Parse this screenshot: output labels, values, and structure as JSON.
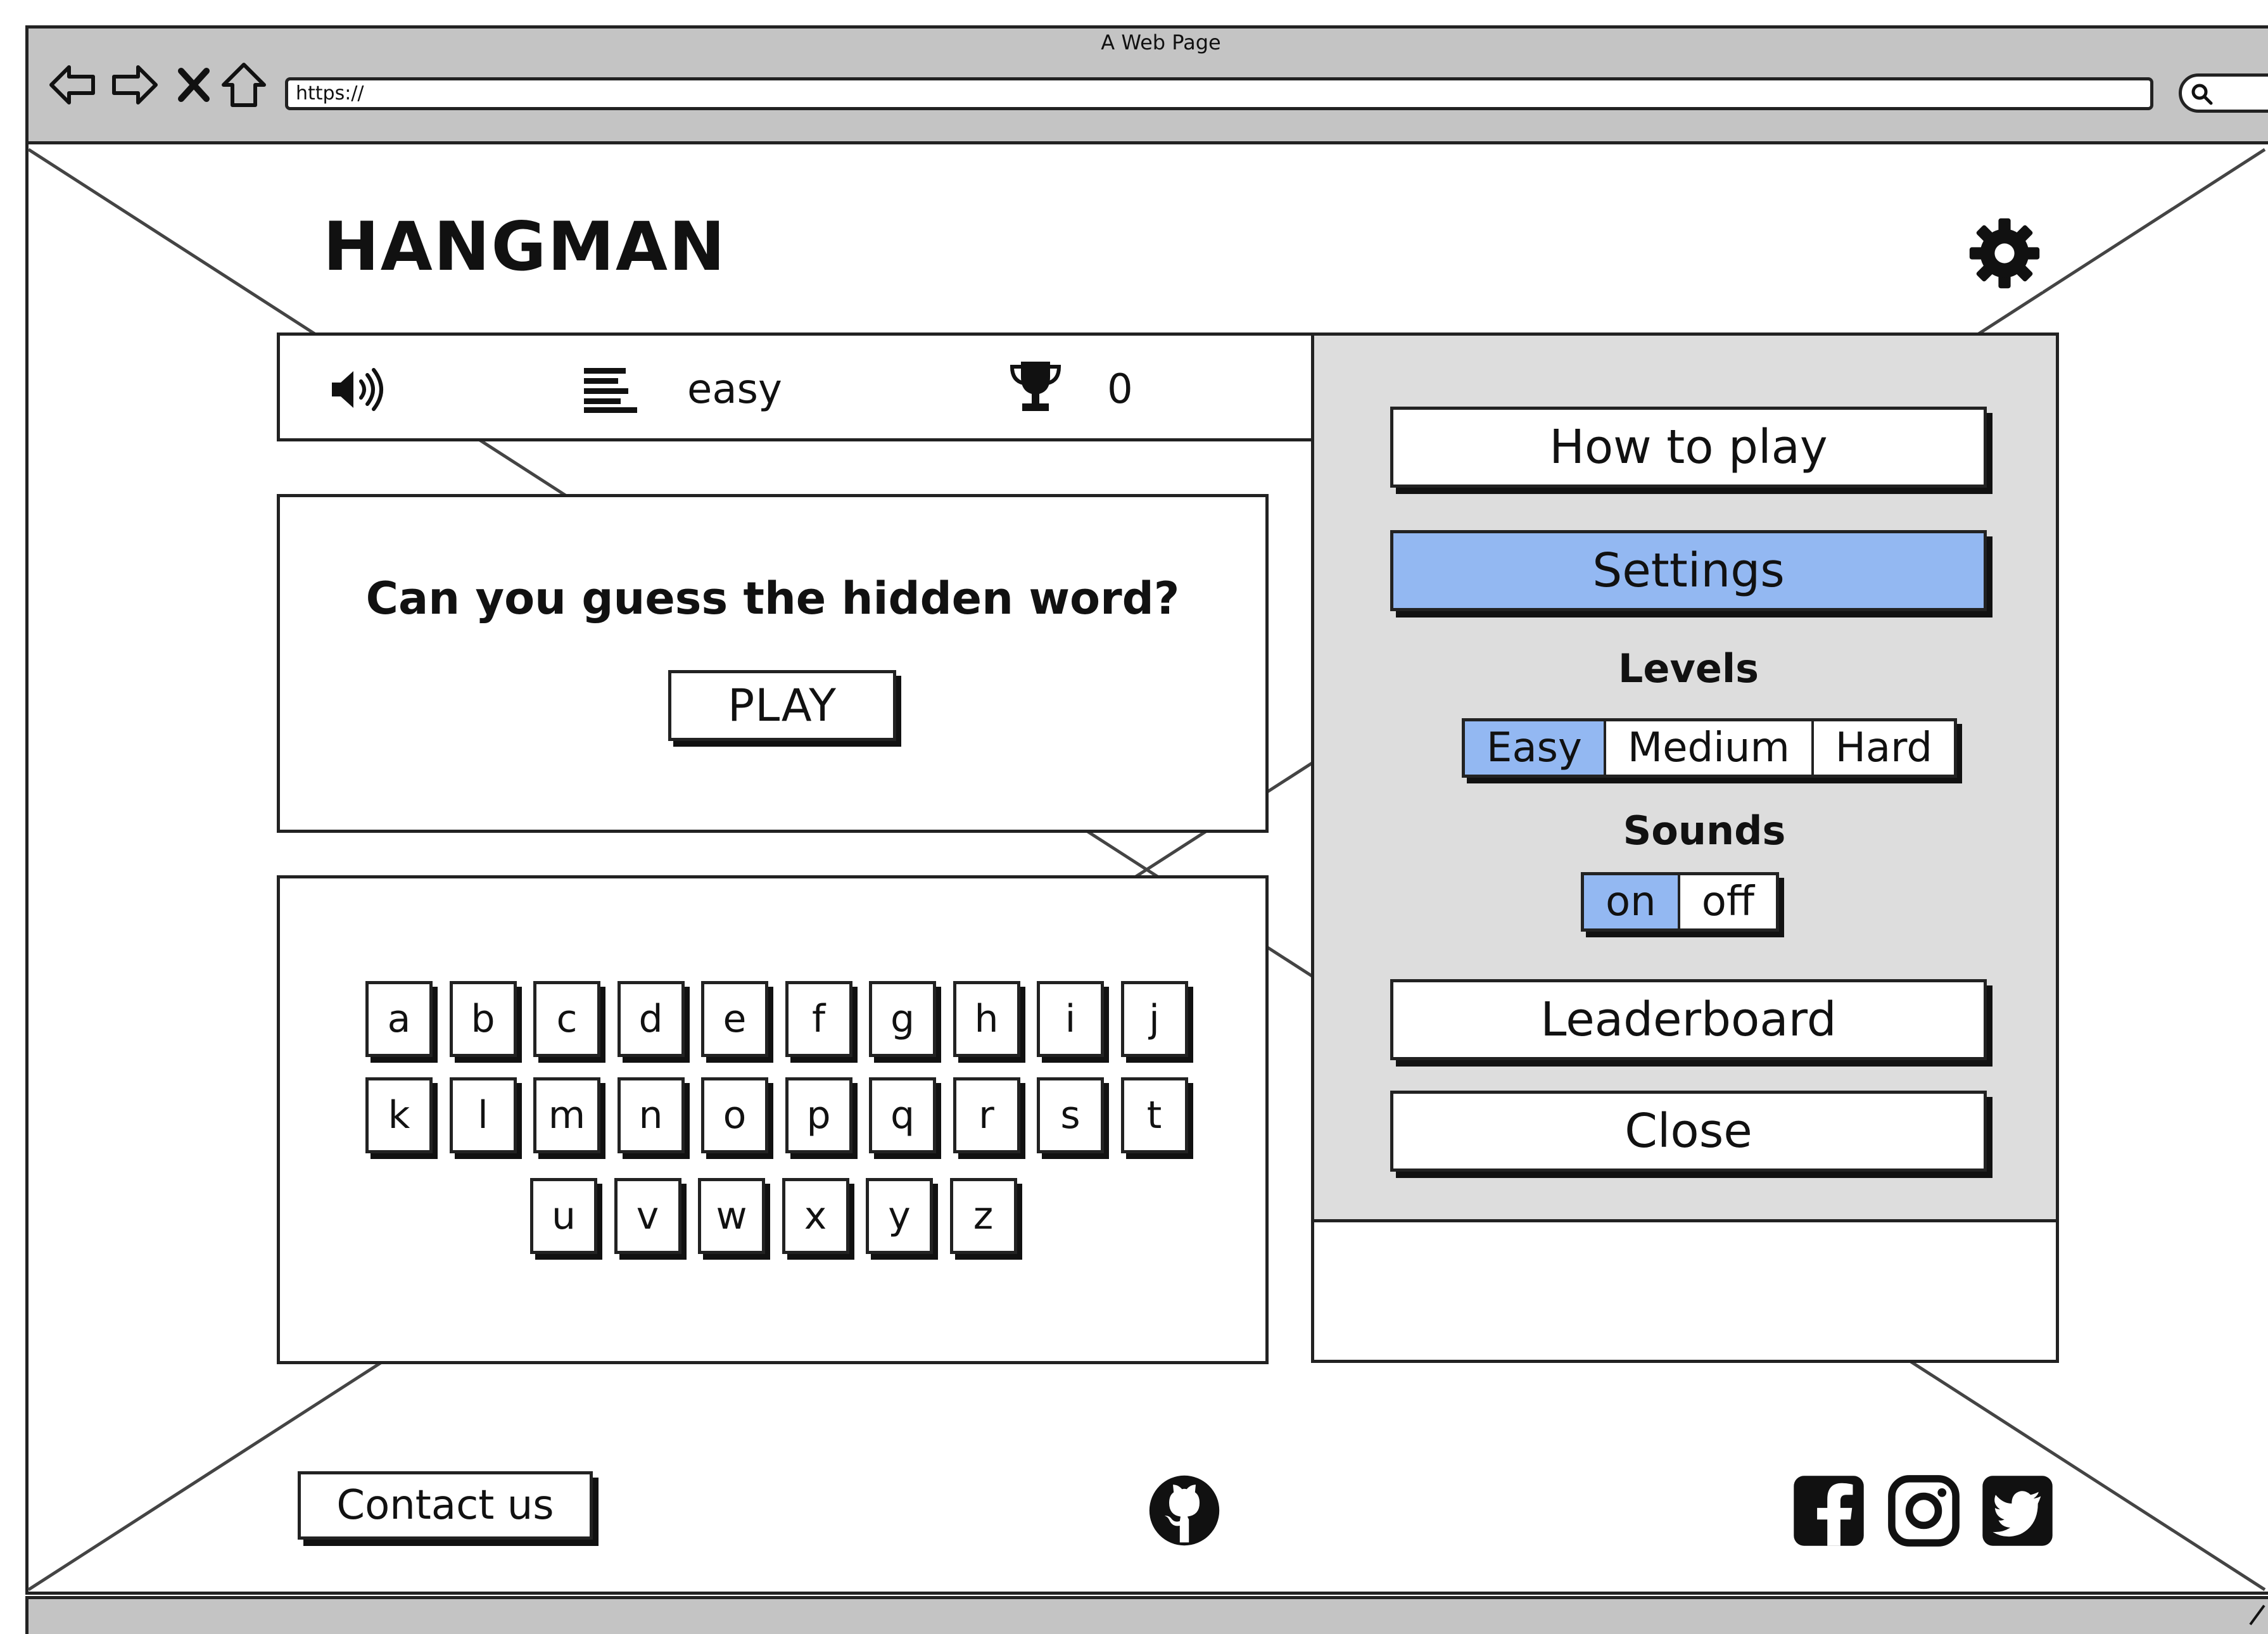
{
  "browser": {
    "window_title": "A Web Page",
    "url": "https://"
  },
  "header": {
    "logo": "HANGMAN",
    "settings_icon": "gear-icon"
  },
  "status": {
    "sound_icon": "speaker-icon",
    "level_icon": "align-left-icon",
    "level": "easy",
    "trophy_icon": "trophy-icon",
    "score": "0"
  },
  "game": {
    "prompt": "Can you guess the hidden word?",
    "play_label": "PLAY"
  },
  "keyboard": {
    "rows": [
      [
        "a",
        "b",
        "c",
        "d",
        "e",
        "f",
        "g",
        "h",
        "i",
        "j"
      ],
      [
        "k",
        "l",
        "m",
        "n",
        "o",
        "p",
        "q",
        "r",
        "s",
        "t"
      ],
      [
        "u",
        "v",
        "w",
        "x",
        "y",
        "z"
      ]
    ]
  },
  "menu": {
    "how_to_play": "How to play",
    "settings": "Settings",
    "levels_label": "Levels",
    "levels": [
      "Easy",
      "Medium",
      "Hard"
    ],
    "selected_level": "Easy",
    "sounds_label": "Sounds",
    "sounds": [
      "on",
      "off"
    ],
    "selected_sound": "on",
    "leaderboard": "Leaderboard",
    "close": "Close"
  },
  "footer": {
    "contact_label": "Contact us",
    "icons": [
      "github-icon",
      "facebook-icon",
      "instagram-icon",
      "twitter-icon"
    ]
  },
  "colors": {
    "accent": "#93b8f2",
    "panel_bg": "#dddddd",
    "chrome_bg": "#c4c4c4",
    "ink": "#111111"
  }
}
